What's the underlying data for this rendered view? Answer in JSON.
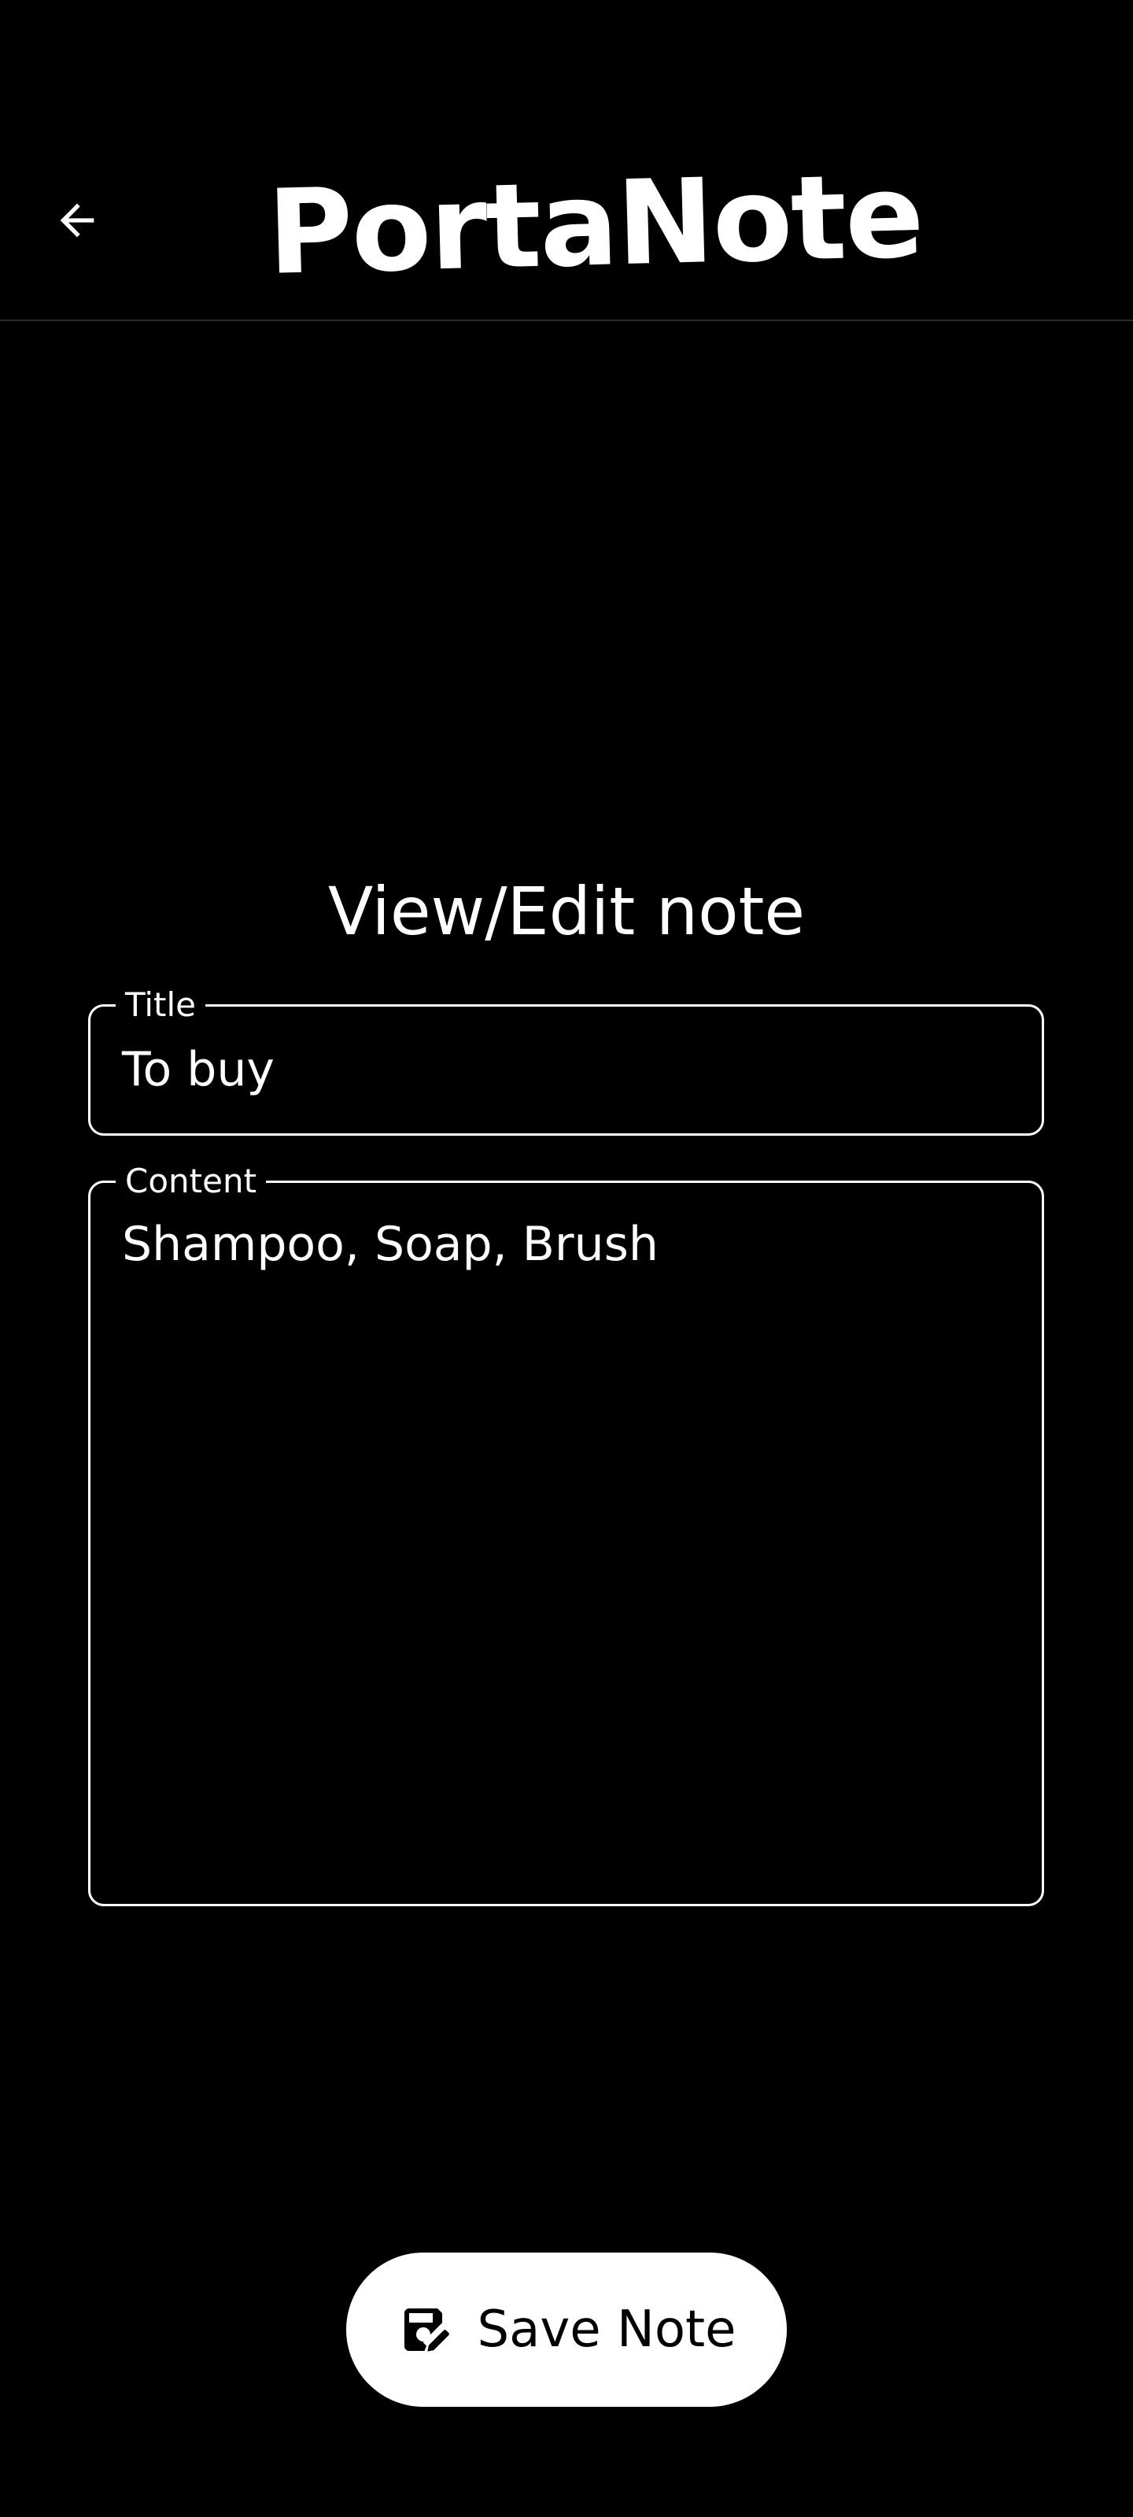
{
  "app_bar": {
    "title": "PortaNote",
    "back_icon": "arrow-back-icon"
  },
  "page": {
    "heading": "View/Edit note"
  },
  "form": {
    "title_label": "Title",
    "title_value": "To buy",
    "content_label": "Content",
    "content_value": "Shampoo, Soap, Brush"
  },
  "actions": {
    "save_label": "Save Note",
    "save_icon": "save-edit-icon"
  },
  "colors": {
    "background": "#000000",
    "foreground": "#ffffff",
    "button_bg": "#ffffff",
    "button_text": "#000000"
  }
}
